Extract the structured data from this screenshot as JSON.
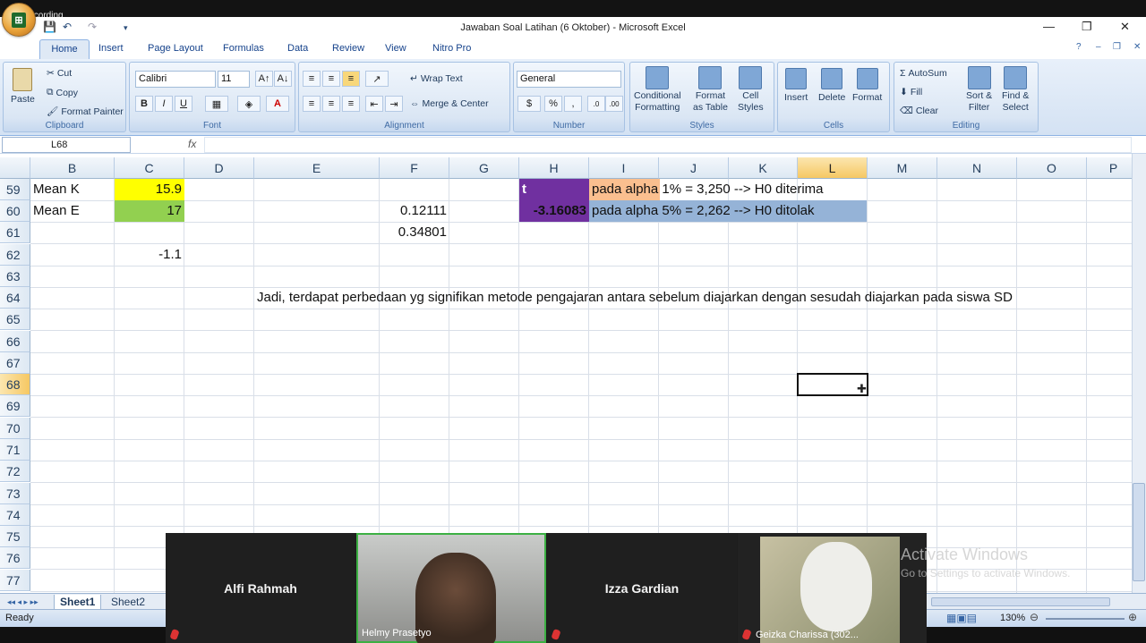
{
  "recording_label": "Recording",
  "window": {
    "title": "Jawaban Soal Latihan (6 Oktober) - Microsoft Excel",
    "minimize": "—",
    "restore": "❐",
    "close": "✕"
  },
  "ribbon_tabs": [
    "Home",
    "Insert",
    "Page Layout",
    "Formulas",
    "Data",
    "Review",
    "View",
    "Nitro Pro"
  ],
  "clipboard": {
    "paste": "Paste",
    "cut": "Cut",
    "copy": "Copy",
    "format_painter": "Format Painter",
    "label": "Clipboard"
  },
  "font": {
    "name": "Calibri",
    "size": "11",
    "label": "Font",
    "bold": "B",
    "italic": "I",
    "underline": "U"
  },
  "alignment": {
    "wrap_text": "Wrap Text",
    "merge_center": "Merge & Center",
    "label": "Alignment"
  },
  "number": {
    "format": "General",
    "currency": "$",
    "percent": "%",
    "comma": ",",
    "label": "Number"
  },
  "styles": {
    "conditional": "Conditional",
    "conditional2": "Formatting",
    "format_table": "Format",
    "format_table2": "as Table",
    "cell_styles": "Cell",
    "cell_styles2": "Styles",
    "label": "Styles"
  },
  "cells": {
    "insert": "Insert",
    "delete": "Delete",
    "format": "Format",
    "label": "Cells"
  },
  "editing": {
    "autosum": "AutoSum",
    "fill": "Fill",
    "clear": "Clear",
    "sort": "Sort &",
    "sort2": "Filter",
    "find": "Find &",
    "find2": "Select",
    "label": "Editing"
  },
  "formula_bar": {
    "name_box": "L68",
    "fx": "fx",
    "value": ""
  },
  "columns": [
    "B",
    "C",
    "D",
    "E",
    "F",
    "G",
    "H",
    "I",
    "J",
    "K",
    "L",
    "M",
    "N",
    "O",
    "P"
  ],
  "selected_column": "L",
  "rows": [
    "59",
    "60",
    "61",
    "62",
    "63",
    "64",
    "65",
    "66",
    "67",
    "68",
    "69",
    "70",
    "71",
    "72",
    "73",
    "74",
    "75",
    "76",
    "77"
  ],
  "selected_row": "68",
  "cells_data": {
    "B59": "Mean K",
    "C59": "15.9",
    "H59": "t",
    "I59": "pada alpha 1% = 3,250 --> H0 diterima",
    "B60": "Mean E",
    "C60": "17",
    "F60": "0.12111",
    "H60": "-3.16083",
    "I60": "pada alpha 5% = 2,262 --> H0 ditolak",
    "F61": "0.34801",
    "C62": "-1.1",
    "E64": "Jadi, terdapat perbedaan yg signifikan metode pengajaran antara sebelum diajarkan dengan sesudah diajarkan pada siswa SD"
  },
  "colors": {
    "yellow": "#ffff00",
    "green": "#92d050",
    "purple": "#7030a0",
    "orange": "#fabf8f",
    "blue": "#95b3d7"
  },
  "sheets": [
    "Sheet1",
    "Sheet2"
  ],
  "status": {
    "ready": "Ready",
    "zoom": "130%"
  },
  "participants": [
    {
      "name": "Alfi Rahmah"
    },
    {
      "name": "Helmy Prasetyo"
    },
    {
      "name": "Izza Gardian"
    },
    {
      "name": "Geizka Charissa (302..."
    }
  ],
  "watermark": {
    "line1": "Activate Windows",
    "line2": "Go to Settings to activate Windows."
  }
}
